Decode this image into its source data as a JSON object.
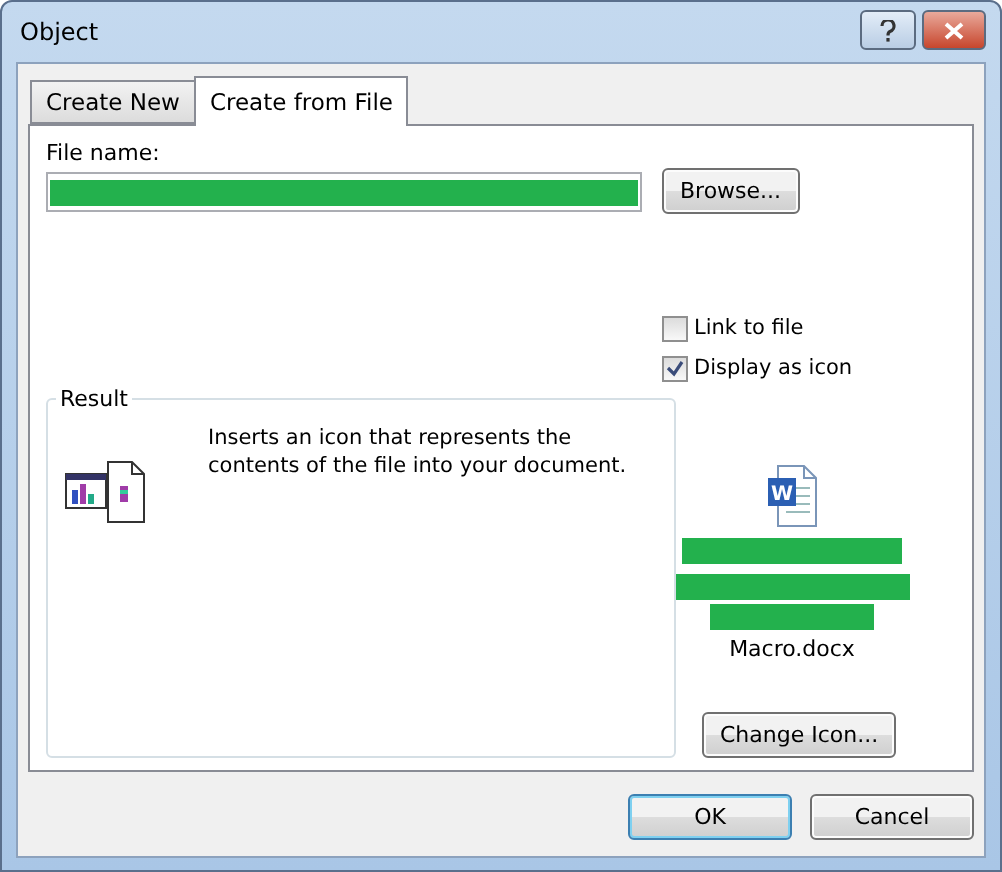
{
  "window": {
    "title": "Object"
  },
  "tabs": [
    {
      "label": "Create New",
      "selected": false
    },
    {
      "label": "Create from File",
      "selected": true
    }
  ],
  "file_name": {
    "label": "File name:"
  },
  "browse_button": "Browse...",
  "options": [
    {
      "label": "Link to file",
      "checked": false
    },
    {
      "label": "Display as icon",
      "checked": true
    }
  ],
  "result": {
    "title": "Result",
    "text": "Inserts an icon that represents the contents of the file into your document."
  },
  "icon_letter": "W",
  "icon_caption": "Macro.docx",
  "change_icon_button": "Change Icon...",
  "buttons": [
    {
      "label": "OK",
      "default": true
    },
    {
      "label": "Cancel",
      "default": false
    }
  ]
}
